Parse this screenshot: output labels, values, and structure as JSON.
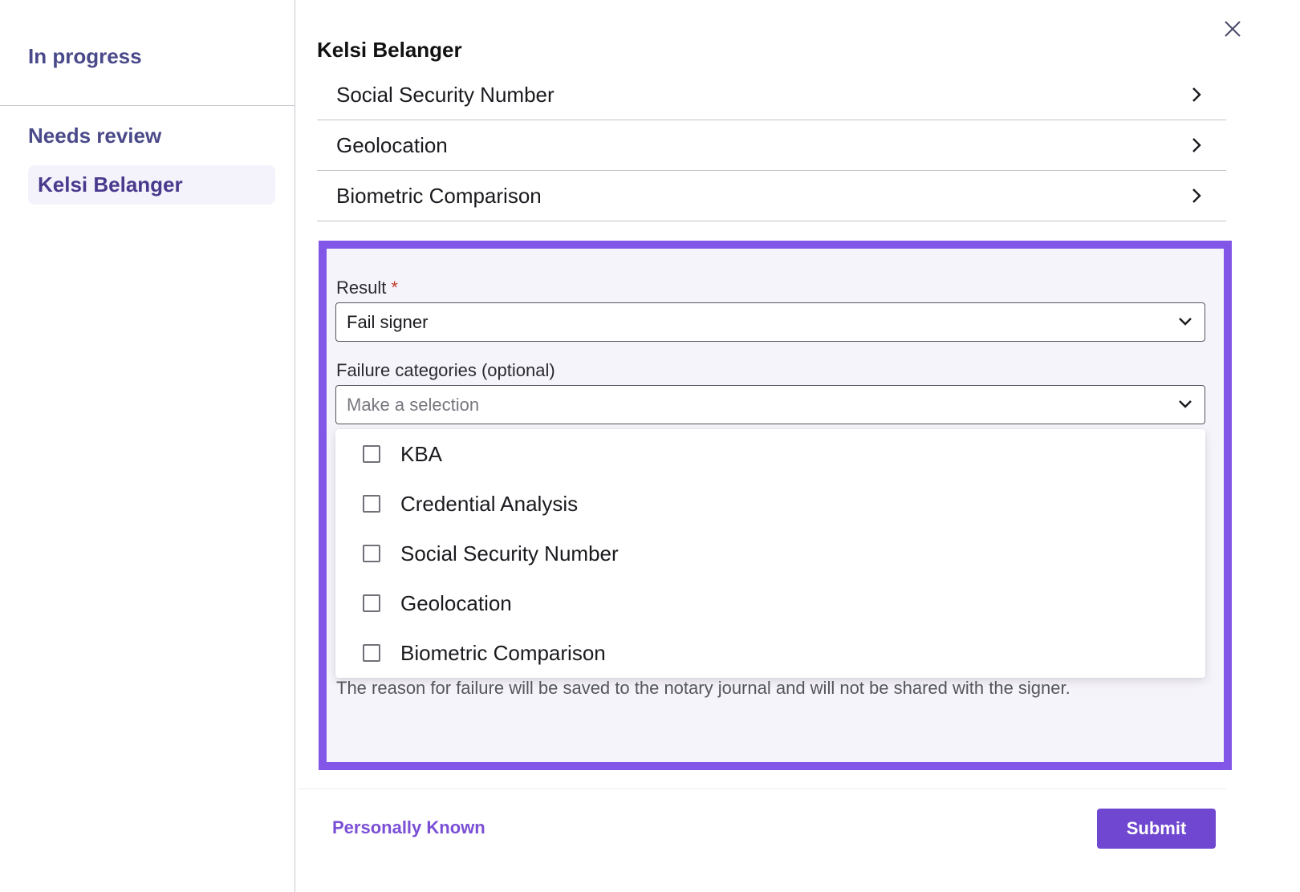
{
  "sidebar": {
    "in_progress_label": "In progress",
    "needs_review_label": "Needs review",
    "selected_item": "Kelsi Belanger"
  },
  "main": {
    "signer_name": "Kelsi Belanger",
    "checks": [
      {
        "label": "Social Security Number"
      },
      {
        "label": "Geolocation"
      },
      {
        "label": "Biometric Comparison"
      }
    ]
  },
  "form": {
    "result_label": "Result",
    "required_marker": "*",
    "result_value": "Fail signer",
    "failure_label": "Failure categories (optional)",
    "failure_placeholder": "Make a selection",
    "options": [
      {
        "label": "KBA",
        "checked": false
      },
      {
        "label": "Credential Analysis",
        "checked": false
      },
      {
        "label": "Social Security Number",
        "checked": false
      },
      {
        "label": "Geolocation",
        "checked": false
      },
      {
        "label": "Biometric Comparison",
        "checked": false
      }
    ],
    "help_text": "The reason for failure will be saved to the notary journal and will not be shared with the signer."
  },
  "footer": {
    "personally_known_label": "Personally Known",
    "submit_label": "Submit"
  },
  "colors": {
    "accent": "#8257e8",
    "button": "#6f47d0",
    "sidebar_heading": "#4a4a8a"
  },
  "icons": {
    "close": "close-icon",
    "chevron_right": "chevron-right-icon",
    "chevron_down": "chevron-down-icon",
    "checkbox": "checkbox-icon"
  }
}
